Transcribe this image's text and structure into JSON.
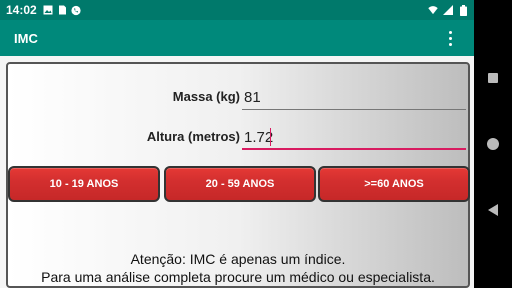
{
  "status_bar": {
    "time": "14:02",
    "left_icons": [
      "image-icon",
      "sim-icon",
      "phone-icon"
    ],
    "right_icons": [
      "wifi-icon",
      "signal-icon",
      "battery-icon"
    ]
  },
  "app_bar": {
    "title": "IMC",
    "menu_icon": "more-vert-icon"
  },
  "form": {
    "mass": {
      "label": "Massa (kg)",
      "value": "81"
    },
    "height": {
      "label": "Altura (metros)",
      "value": "1.72"
    }
  },
  "buttons": [
    {
      "label": "10 - 19 ANOS"
    },
    {
      "label": "20 - 59 ANOS"
    },
    {
      "label": ">=60 ANOS"
    }
  ],
  "notice": {
    "line1": "Atenção: IMC é apenas um índice.",
    "line2": "Para uma análise completa procure um médico ou especialista."
  },
  "colors": {
    "status_bar": "#00796b",
    "app_bar": "#00897b",
    "button_red": "#d32f2f",
    "accent": "#d81b60"
  }
}
